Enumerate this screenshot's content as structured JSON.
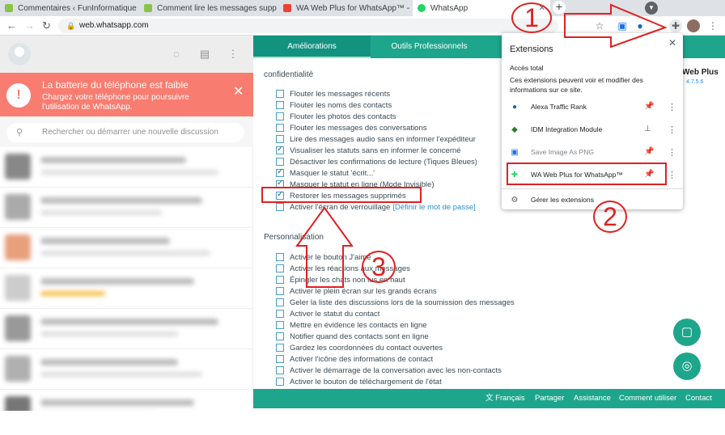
{
  "browser": {
    "tabs": [
      {
        "title": "Commentaires ‹ FunInformatique",
        "color": "#8bc34a"
      },
      {
        "title": "Comment lire les messages supp",
        "color": "#8bc34a"
      },
      {
        "title": "WA Web Plus for WhatsApp™ - C",
        "color": "#ea4335"
      },
      {
        "title": "WhatsApp",
        "color": "#25d366"
      }
    ],
    "new_tab": "+",
    "url": "web.whatsapp.com"
  },
  "left": {
    "battery_title": "La batterie du téléphone est faible",
    "battery_sub": "Chargez votre téléphone pour poursuivre l'utilisation de WhatsApp.",
    "search_placeholder": "Rechercher ou démarrer une nouvelle discussion"
  },
  "right": {
    "tabs": [
      "Améliorations",
      "Outils Professionnels"
    ],
    "section_privacy": "confidentialité",
    "privacy": [
      {
        "label": "Flouter les messages récents",
        "checked": false
      },
      {
        "label": "Flouter les noms des contacts",
        "checked": false
      },
      {
        "label": "Flouter les photos des contacts",
        "checked": false
      },
      {
        "label": "Flouter les messages des conversations",
        "checked": false
      },
      {
        "label": "Lire des messages audio sans en informer l'expéditeur",
        "checked": false
      },
      {
        "label": "Visualiser les statuts sans en informer le concerné",
        "checked": true
      },
      {
        "label": "Désactiver les confirmations de lecture (Tiques Bleues)",
        "checked": false
      },
      {
        "label": "Masquer le statut 'écrit...'",
        "checked": true
      },
      {
        "label": "Masquer le statut en ligne (Mode Invisible)",
        "checked": true
      },
      {
        "label": "Restorer les messages supprimés",
        "checked": true
      },
      {
        "label": "Activer l'écran de verrouillage",
        "checked": false,
        "link": "[Définir le mot de passe]"
      }
    ],
    "section_perso": "Personnalisation",
    "perso": [
      "Activer le bouton J'aime",
      "Activer les réactions aux messages",
      "Épingler les chats non lus en haut",
      "Activer le plein écran sur les grands écrans",
      "Geler la liste des discussions lors de la soumission des messages",
      "Activer le statut du contact",
      "Mettre en évidence les contacts en ligne",
      "Notifier quand des contacts sont en ligne",
      "Gardez les coordonnées du contact ouvertes",
      "Activer l'icône des informations de contact",
      "Activer le démarrage de la conversation avec les non-contacts",
      "Activer le bouton de téléchargement de l'état"
    ],
    "side_title": "Web Plus",
    "side_version": "4.7.5.6",
    "footer": [
      "Français",
      "Partager",
      "Assistance",
      "Comment utiliser",
      "Contact"
    ]
  },
  "popup": {
    "title": "Extensions",
    "subtitle": "Accès total",
    "desc": "Ces extensions peuvent voir et modifier des informations sur ce site.",
    "items": [
      {
        "name": "Alexa Traffic Rank",
        "pinned": true
      },
      {
        "name": "IDM Integration Module",
        "pinned": false
      },
      {
        "name": "Save Image As PNG",
        "pinned": true
      },
      {
        "name": "WA Web Plus for WhatsApp™",
        "pinned": true
      }
    ],
    "manage": "Gérer les extensions"
  },
  "annotations": [
    "1",
    "2",
    "3"
  ]
}
